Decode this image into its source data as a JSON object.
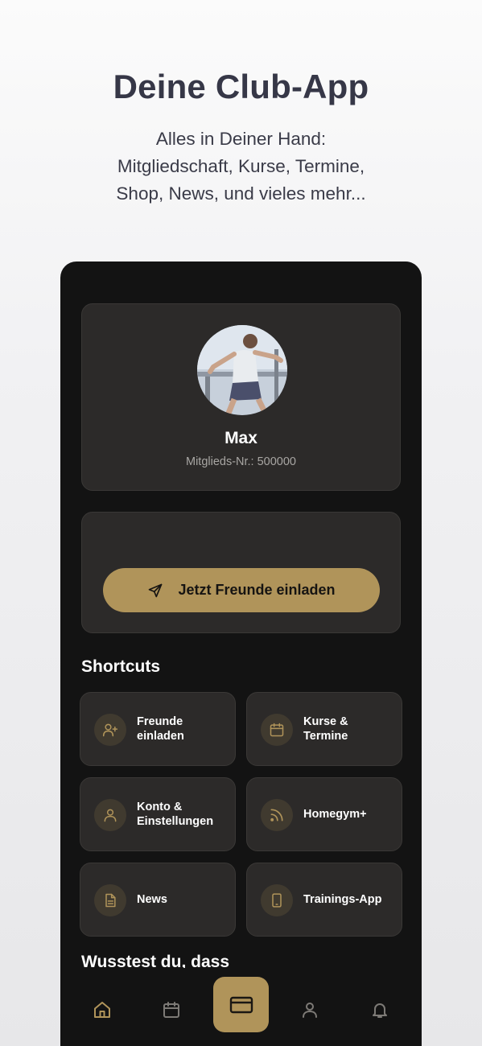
{
  "hero": {
    "title": "Deine Club-App",
    "subtitle_lines": [
      "Alles in Deiner Hand:",
      "Mitgliedschaft, Kurse, Termine,",
      "Shop, News, und vieles mehr..."
    ]
  },
  "profile": {
    "name": "Max",
    "member_number": "Mitglieds-Nr.: 500000"
  },
  "invite": {
    "button_label": "Jetzt Freunde einladen",
    "button_icon": "send-icon"
  },
  "shortcuts": {
    "title": "Shortcuts",
    "items": [
      {
        "line1": "Freunde",
        "line2": "einladen",
        "icon": "user-plus-icon"
      },
      {
        "line1": "Kurse &",
        "line2": "Termine",
        "icon": "calendar-icon"
      },
      {
        "line1": "Konto &",
        "line2": "Einstellungen",
        "icon": "user-icon"
      },
      {
        "line1": "Homegym+",
        "line2": "",
        "icon": "rss-icon"
      },
      {
        "line1": "News",
        "line2": "",
        "icon": "document-icon"
      },
      {
        "line1": "Trainings-App",
        "line2": "",
        "icon": "smartphone-icon"
      }
    ]
  },
  "did_you_know": {
    "title": "Wusstest du, dass"
  },
  "nav": {
    "items": [
      "home-icon",
      "calendar-icon",
      "card-icon",
      "user-icon",
      "bell-icon"
    ]
  },
  "colors": {
    "accent": "#b0945a",
    "card": "#2c2a29",
    "phone_bg": "#131313",
    "icon_bg": "#403a2f"
  }
}
